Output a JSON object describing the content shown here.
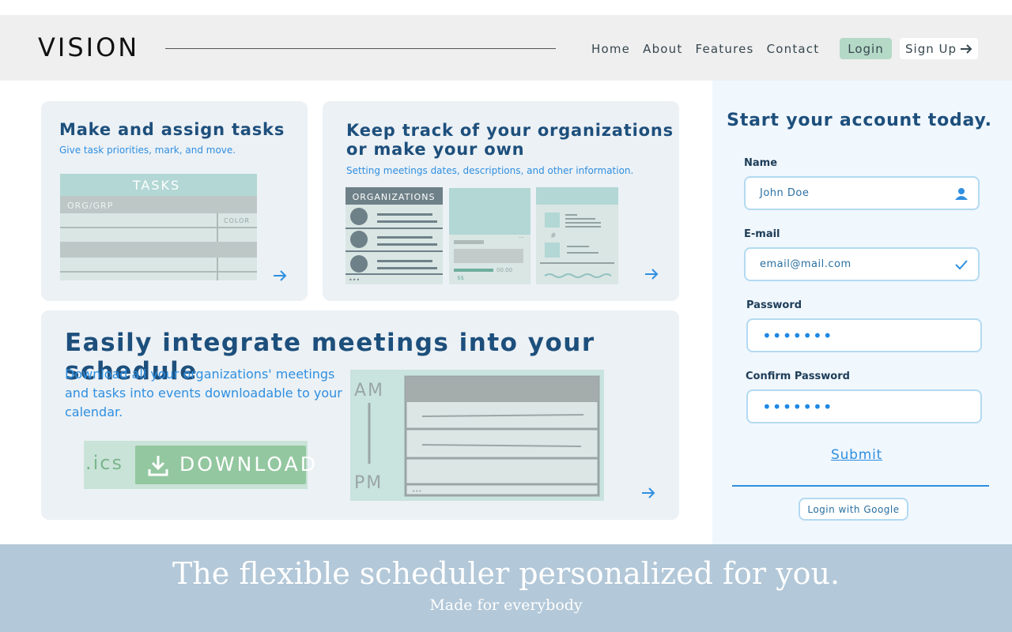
{
  "header": {
    "logo": "VISION",
    "nav": [
      "Home",
      "About",
      "Features",
      "Contact"
    ],
    "login_label": "Login",
    "signup_label": "Sign Up"
  },
  "cards": {
    "tasks": {
      "title": "Make and assign tasks",
      "subtitle": "Give task priorities, mark, and move.",
      "illus": {
        "header": "TASKS",
        "row": "ORG/GRP",
        "col": "COLOR"
      }
    },
    "orgs": {
      "title_line1": "Keep track of your organizations",
      "title_line2": "or make your own",
      "subtitle": "Setting meetings dates, descriptions, and other information.",
      "illus": {
        "header": "ORGANIZATIONS",
        "price": "$$",
        "time": "00.00",
        "dots": "•••",
        "hash": "#"
      }
    },
    "schedule": {
      "title": "Easily integrate meetings into your schedule",
      "desc_line1": "Download all your organizations' meetings",
      "desc_line2": "and tasks into events downloadable to your",
      "desc_line3": "calendar.",
      "ics": ".ics",
      "download_label": "DOWNLOAD",
      "am": "AM",
      "pm": "PM",
      "dots": "•••"
    }
  },
  "signup": {
    "title": "Start your account today.",
    "name_label": "Name",
    "name_value": "John Doe",
    "email_label": "E-mail",
    "email_value": "email@mail.com",
    "password_label": "Password",
    "password_value": "•••••••",
    "confirm_label": "Confirm Password",
    "confirm_value": "•••••••",
    "submit_label": "Submit",
    "google_label": "Login with Google"
  },
  "footer": {
    "title": "The flexible scheduler personalized for you.",
    "subtitle": "Made for everybody"
  },
  "colors": {
    "accent": "#2f8fe0",
    "title": "#1d4f7c",
    "card_bg": "#ecf1f5",
    "footer_bg": "#b3c8d8",
    "login_bg": "#b5d9c7",
    "download_bg": "#93c7a0"
  }
}
